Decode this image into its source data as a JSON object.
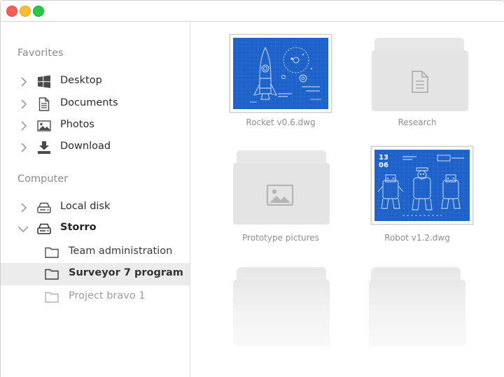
{
  "window": {
    "controls": [
      "close",
      "minimize",
      "maximize"
    ],
    "colors": {
      "close": "#fb5f57",
      "minimize": "#fdbc2e",
      "maximize": "#28c940"
    }
  },
  "sidebar": {
    "favorites_title": "Favorites",
    "favorites": [
      {
        "label": "Desktop",
        "icon": "windows-icon"
      },
      {
        "label": "Documents",
        "icon": "document-icon"
      },
      {
        "label": "Photos",
        "icon": "image-icon"
      },
      {
        "label": "Download",
        "icon": "download-icon"
      }
    ],
    "computer_title": "Computer",
    "computer": [
      {
        "label": "Local disk",
        "icon": "drive-icon",
        "expanded": false
      },
      {
        "label": "Storro",
        "icon": "drive-icon",
        "expanded": true
      }
    ],
    "storro_children": [
      {
        "label": "Team administration",
        "icon": "folder-icon"
      },
      {
        "label": "Surveyor 7 program",
        "icon": "folder-icon",
        "selected": true
      },
      {
        "label": "Project bravo 1",
        "icon": "folder-icon"
      }
    ],
    "selected_color": "#ebebeb"
  },
  "files": [
    {
      "name": "Rocket v0.6.dwg",
      "kind": "blueprint-rocket"
    },
    {
      "name": "Research",
      "kind": "folder-document"
    },
    {
      "name": "Prototype pictures",
      "kind": "folder-image"
    },
    {
      "name": "Robot v1.2.dwg",
      "kind": "blueprint-robot",
      "label_1": "13",
      "label_2": "06"
    },
    {
      "name": "",
      "kind": "folder-empty"
    },
    {
      "name": "",
      "kind": "folder-empty"
    }
  ],
  "colors": {
    "blueprint": "#1e62c9",
    "folder": "#e4e4e4",
    "caption": "#8e8e8e"
  }
}
